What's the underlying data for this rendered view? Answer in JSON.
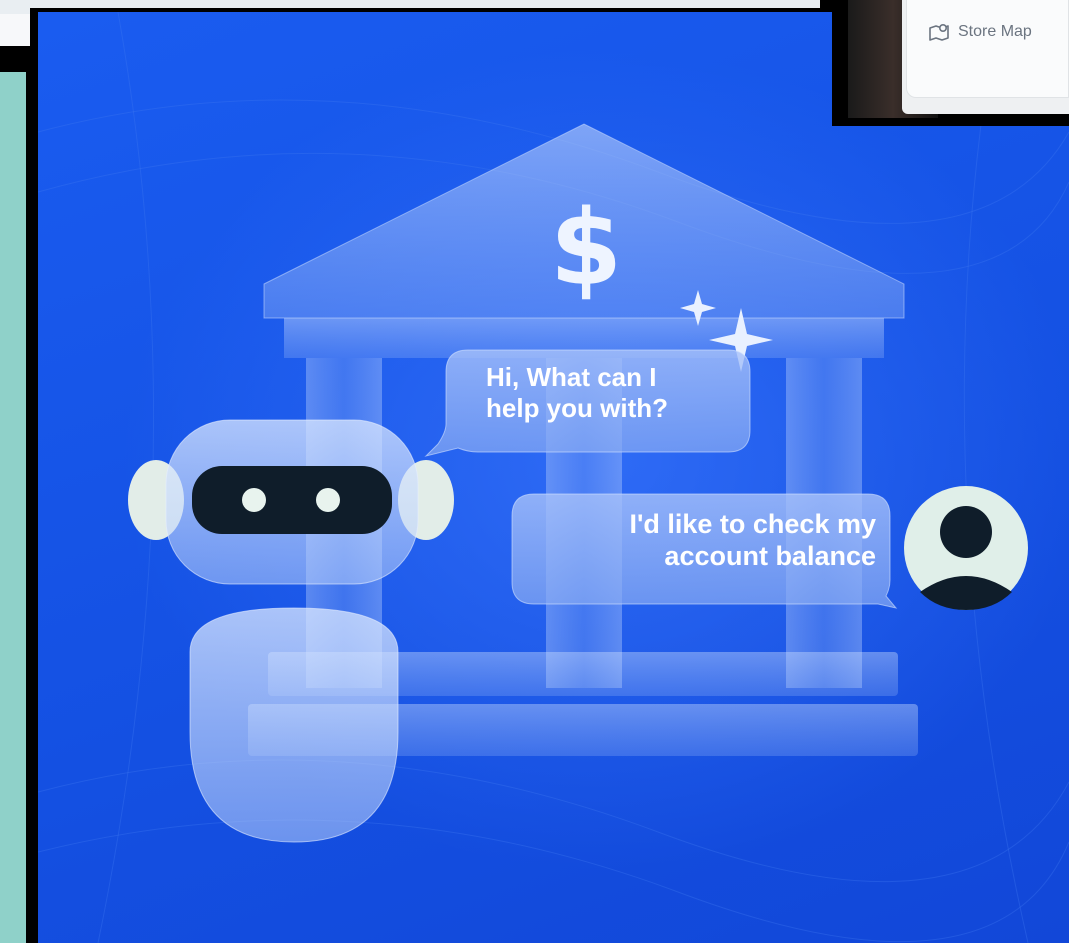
{
  "phone": {
    "store_map_label": "Store Map",
    "icon": "map-pin-icon"
  },
  "illustration": {
    "bank_symbol": "$",
    "bot_message": [
      "Hi, What can I",
      "help you with?"
    ],
    "user_message": [
      "I'd like to check my",
      "account balance"
    ],
    "colors": {
      "background": "#1656e8",
      "bubble": "#8fb0f5",
      "robot_visor": "#0f1d2a",
      "robot_eyes": "#e8f3ee",
      "user_avatar_bg": "#e0efe9",
      "user_avatar_fg": "#0f1d2a"
    }
  }
}
